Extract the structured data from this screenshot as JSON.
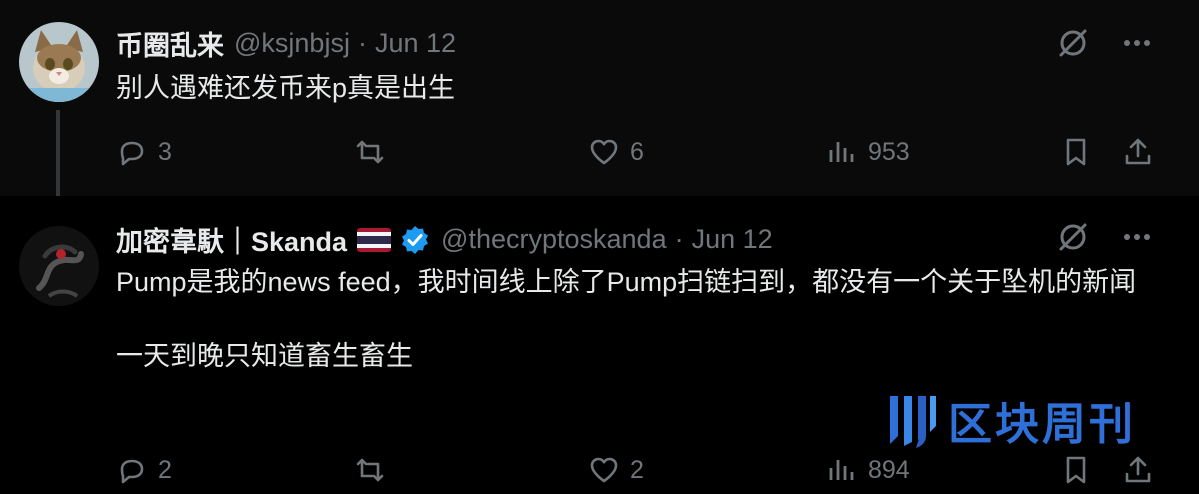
{
  "tweets": [
    {
      "display_name": "币圈乱来",
      "handle": "@ksjnbjsj",
      "separator": "·",
      "date": "Jun 12",
      "paragraphs": [
        "别人遇难还发币来p真是出生"
      ],
      "replies": "3",
      "likes": "6",
      "views": "953"
    },
    {
      "display_name": "加密韋馱｜Skanda",
      "handle": "@thecryptoskanda",
      "separator": "·",
      "date": "Jun 12",
      "paragraphs": [
        "Pump是我的news feed，我时间线上除了Pump扫链扫到，都没有一个关于坠机的新闻",
        "一天到晚只知道畜生畜生"
      ],
      "replies": "2",
      "likes": "2",
      "views": "894"
    }
  ],
  "watermark": {
    "text": "区块周刊"
  },
  "colors": {
    "muted": "#71767b",
    "text": "#e7e9ea",
    "verified": "#1d9bf0",
    "watermark": "#2f6fd8"
  }
}
